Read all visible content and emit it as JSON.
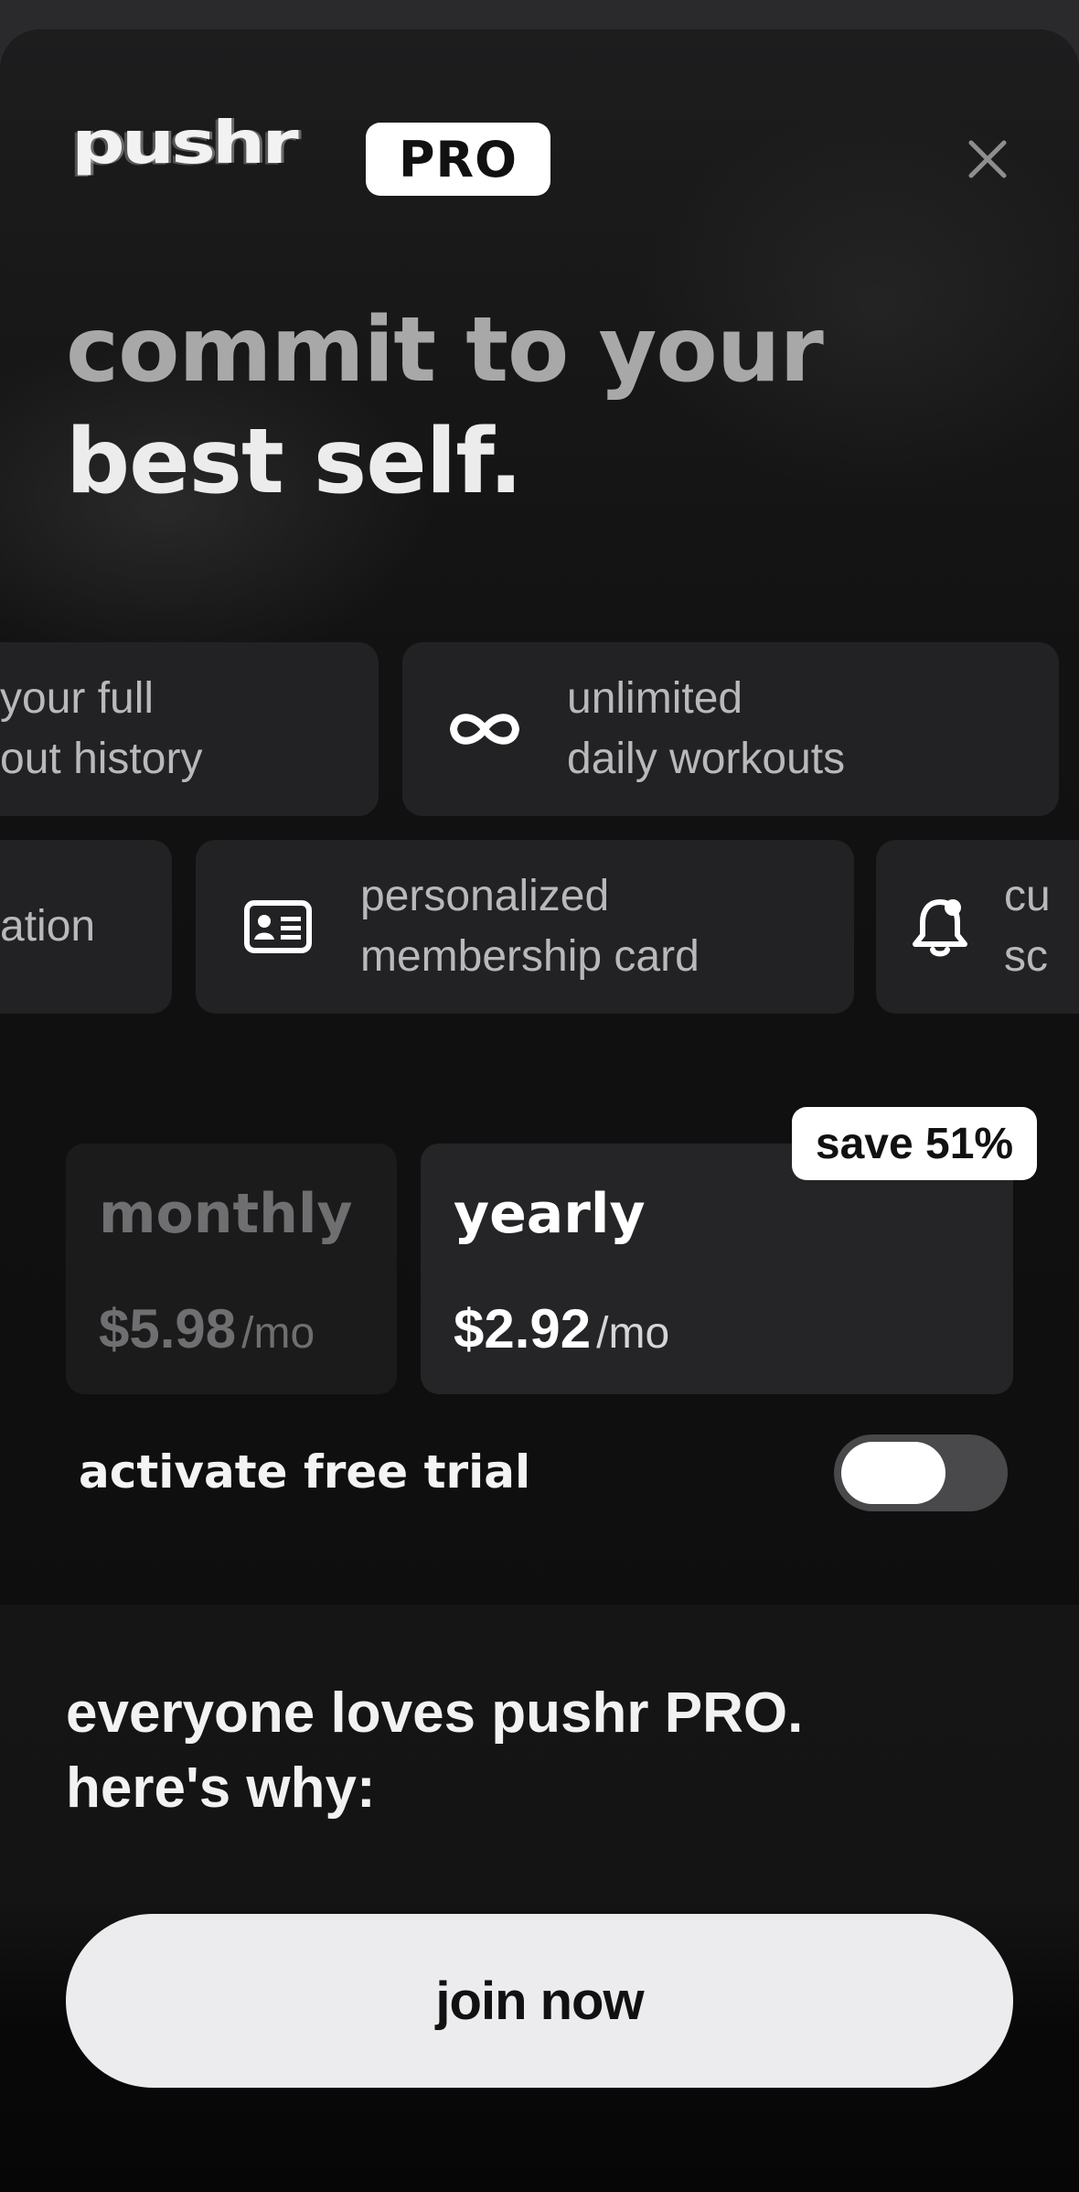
{
  "header": {
    "logo_text": "pushr",
    "pro_badge": "PRO"
  },
  "headline": {
    "line1": "commit to your",
    "line2": "best self."
  },
  "features": {
    "row1": [
      {
        "text": "your full\nout history",
        "icon": null
      },
      {
        "text": "unlimited\ndaily workouts",
        "icon": "infinity-icon"
      }
    ],
    "row2": [
      {
        "text": "ation\n",
        "icon": null
      },
      {
        "text": "personalized\nmembership card",
        "icon": "id-card-icon"
      },
      {
        "text": "cu\nsc",
        "icon": "bell-icon"
      }
    ]
  },
  "plans": {
    "monthly": {
      "name": "monthly",
      "price": "$5.98",
      "per": "/mo",
      "selected": false
    },
    "yearly": {
      "name": "yearly",
      "price": "$2.92",
      "per": "/mo",
      "selected": true
    },
    "save_badge": "save 51%"
  },
  "trial": {
    "label": "activate free trial",
    "enabled": false
  },
  "social": {
    "line1": "everyone loves pushr PRO.",
    "line2": "here's why:"
  },
  "cta": {
    "label": "join now"
  },
  "colors": {
    "background": "#0d0d0d",
    "card": "#222224",
    "accent": "#ffffff"
  }
}
